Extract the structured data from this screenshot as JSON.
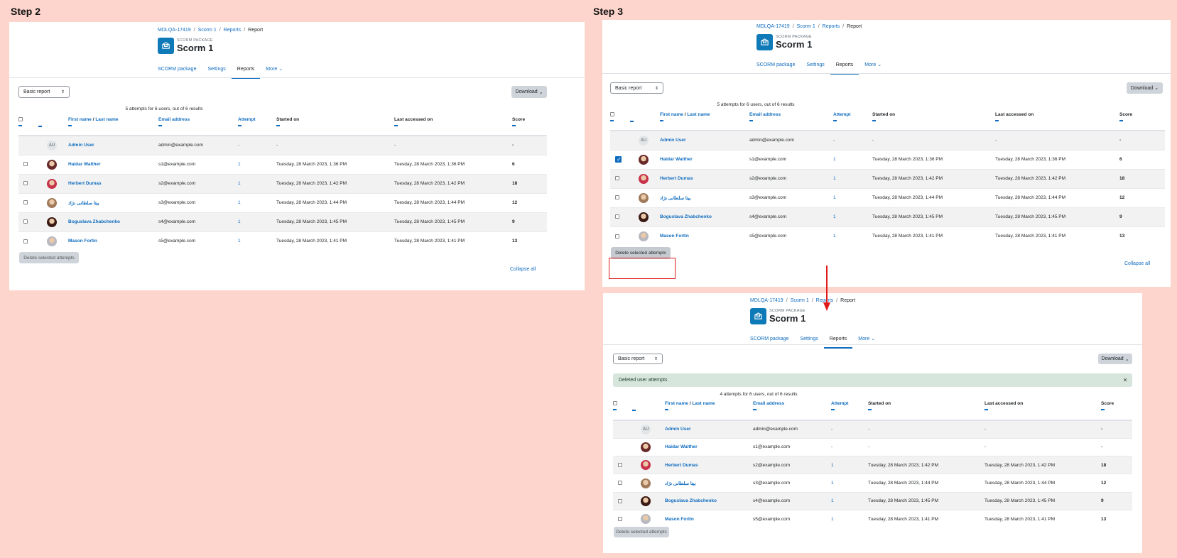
{
  "labels": {
    "step2": "Step 2",
    "step3": "Step 3"
  },
  "breadcrumb": {
    "course": "MDLQA-17419",
    "activity": "Scorm 1",
    "reports": "Reports",
    "current": "Report"
  },
  "page": {
    "type": "SCORM PACKAGE",
    "title": "Scorm 1"
  },
  "tabs": [
    "SCORM package",
    "Settings",
    "Reports",
    "More"
  ],
  "report_select": "Basic report",
  "download": "Download",
  "table_headers": {
    "first_name": "First name",
    "name_sep": "/",
    "last_name": "Last name",
    "email": "Email address",
    "attempt": "Attempt",
    "started": "Started on",
    "last_accessed": "Last accessed on",
    "score": "Score"
  },
  "delete_button": "Delete selected attempts",
  "collapse_all": "Collapse all",
  "icons": {
    "package": "package-icon",
    "chevron": "chevron-down-icon",
    "close": "close-icon"
  },
  "colors": {
    "accent": "#0f6cbf",
    "module": "#0f7ab8",
    "highlight": "#e01a1a",
    "background": "#fdd5cc"
  },
  "step2": {
    "summary": "5 attempts for 6 users, out of 6 results",
    "rows": [
      {
        "initials": "AU",
        "checkbox": false,
        "name": "Admin User",
        "email": "admin@example.com",
        "attempt": "-",
        "started": "-",
        "last": "-",
        "score": "-"
      },
      {
        "checkbox": true,
        "checked": false,
        "avatar": "#6a2a2a",
        "name": "Haidar Walther",
        "email": "s1@example.com",
        "attempt": "1",
        "started": "Tuesday, 28 March 2023, 1:36 PM",
        "last": "Tuesday, 28 March 2023, 1:36 PM",
        "score": "6"
      },
      {
        "checkbox": true,
        "checked": false,
        "avatar": "#c8324a",
        "name": "Herbert Dumas",
        "email": "s2@example.com",
        "attempt": "1",
        "started": "Tuesday, 28 March 2023, 1:42 PM",
        "last": "Tuesday, 28 March 2023, 1:42 PM",
        "score": "18"
      },
      {
        "checkbox": true,
        "checked": false,
        "avatar": "#a07a5a",
        "name": "بیتا سلطانی نژاد",
        "email": "s3@example.com",
        "attempt": "1",
        "started": "Tuesday, 28 March 2023, 1:44 PM",
        "last": "Tuesday, 28 March 2023, 1:44 PM",
        "score": "12"
      },
      {
        "checkbox": true,
        "checked": false,
        "avatar": "#3a1a12",
        "name": "Boguslava Zhabchenko",
        "email": "s4@example.com",
        "attempt": "1",
        "started": "Tuesday, 28 March 2023, 1:45 PM",
        "last": "Tuesday, 28 March 2023, 1:45 PM",
        "score": "9"
      },
      {
        "checkbox": true,
        "checked": false,
        "avatar": "#b8b8c0",
        "name": "Mason Fortin",
        "email": "s5@example.com",
        "attempt": "1",
        "started": "Tuesday, 28 March 2023, 1:41 PM",
        "last": "Tuesday, 28 March 2023, 1:41 PM",
        "score": "13"
      }
    ]
  },
  "step3_top": {
    "summary": "5 attempts for 6 users, out of 6 results",
    "rows": [
      {
        "initials": "AU",
        "checkbox": false,
        "name": "Admin User",
        "email": "admin@example.com",
        "attempt": "-",
        "started": "-",
        "last": "-",
        "score": "-"
      },
      {
        "checkbox": true,
        "checked": true,
        "avatar": "#6a2a2a",
        "name": "Haidar Walther",
        "email": "s1@example.com",
        "attempt": "1",
        "started": "Tuesday, 28 March 2023, 1:36 PM",
        "last": "Tuesday, 28 March 2023, 1:36 PM",
        "score": "6"
      },
      {
        "checkbox": true,
        "checked": false,
        "avatar": "#c8324a",
        "name": "Herbert Dumas",
        "email": "s2@example.com",
        "attempt": "1",
        "started": "Tuesday, 28 March 2023, 1:42 PM",
        "last": "Tuesday, 28 March 2023, 1:42 PM",
        "score": "18"
      },
      {
        "checkbox": true,
        "checked": false,
        "avatar": "#a07a5a",
        "name": "بیتا سلطانی نژاد",
        "email": "s3@example.com",
        "attempt": "1",
        "started": "Tuesday, 28 March 2023, 1:44 PM",
        "last": "Tuesday, 28 March 2023, 1:44 PM",
        "score": "12"
      },
      {
        "checkbox": true,
        "checked": false,
        "avatar": "#3a1a12",
        "name": "Boguslava Zhabchenko",
        "email": "s4@example.com",
        "attempt": "1",
        "started": "Tuesday, 28 March 2023, 1:45 PM",
        "last": "Tuesday, 28 March 2023, 1:45 PM",
        "score": "9"
      },
      {
        "checkbox": true,
        "checked": false,
        "avatar": "#b8b8c0",
        "name": "Mason Fortin",
        "email": "s5@example.com",
        "attempt": "1",
        "started": "Tuesday, 28 March 2023, 1:41 PM",
        "last": "Tuesday, 28 March 2023, 1:41 PM",
        "score": "13"
      }
    ]
  },
  "step3_bottom": {
    "alert": "Deleted user attempts",
    "summary": "4 attempts for 6 users, out of 6 results",
    "rows": [
      {
        "initials": "AU",
        "checkbox": false,
        "name": "Admin User",
        "email": "admin@example.com",
        "attempt": "-",
        "started": "-",
        "last": "-",
        "score": "-"
      },
      {
        "checkbox": false,
        "avatar": "#6a2a2a",
        "name": "Haidar Walther",
        "email": "s1@example.com",
        "attempt": "-",
        "started": "-",
        "last": "-",
        "score": "-"
      },
      {
        "checkbox": true,
        "checked": false,
        "avatar": "#c8324a",
        "name": "Herbert Dumas",
        "email": "s2@example.com",
        "attempt": "1",
        "started": "Tuesday, 28 March 2023, 1:42 PM",
        "last": "Tuesday, 28 March 2023, 1:42 PM",
        "score": "18"
      },
      {
        "checkbox": true,
        "checked": false,
        "avatar": "#a07a5a",
        "name": "بیتا سلطانی نژاد",
        "email": "s3@example.com",
        "attempt": "1",
        "started": "Tuesday, 28 March 2023, 1:44 PM",
        "last": "Tuesday, 28 March 2023, 1:44 PM",
        "score": "12"
      },
      {
        "checkbox": true,
        "checked": false,
        "avatar": "#3a1a12",
        "name": "Boguslava Zhabchenko",
        "email": "s4@example.com",
        "attempt": "1",
        "started": "Tuesday, 28 March 2023, 1:45 PM",
        "last": "Tuesday, 28 March 2023, 1:45 PM",
        "score": "9"
      },
      {
        "checkbox": true,
        "checked": false,
        "avatar": "#b8b8c0",
        "name": "Mason Fortin",
        "email": "s5@example.com",
        "attempt": "1",
        "started": "Tuesday, 28 March 2023, 1:41 PM",
        "last": "Tuesday, 28 March 2023, 1:41 PM",
        "score": "13"
      }
    ]
  }
}
